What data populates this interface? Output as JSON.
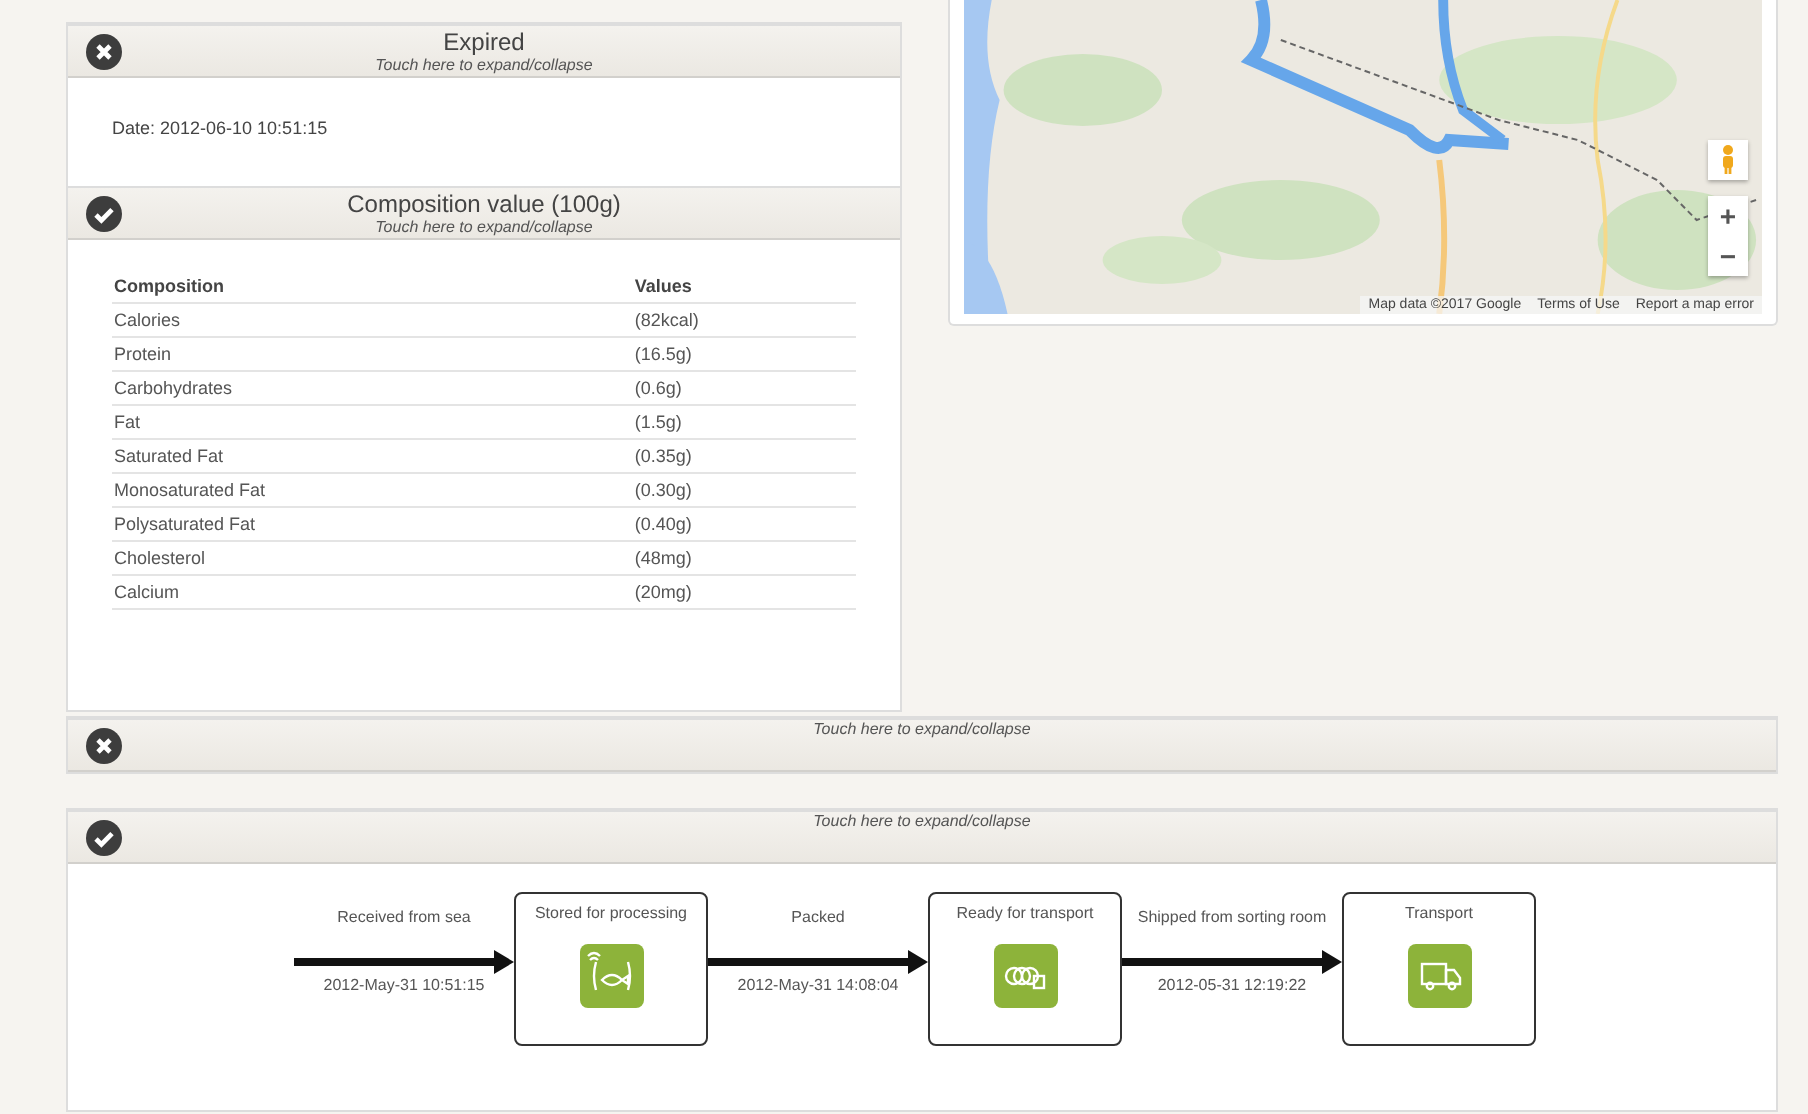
{
  "left_panels": [
    {
      "valid": false,
      "title": "Expired",
      "hint": "Touch here to expand/collapse",
      "kind": "text",
      "text": "Date: 2012-06-10 10:51:15"
    },
    {
      "valid": true,
      "title": "Composition value (100g)",
      "hint": "Touch here to expand/collapse",
      "kind": "table",
      "columns": [
        "Composition",
        "Values"
      ],
      "rows": [
        [
          "Calories",
          "(82kcal)"
        ],
        [
          "Protein",
          "(16.5g)"
        ],
        [
          "Carbohydrates",
          "(0.6g)"
        ],
        [
          "Fat",
          "(1.5g)"
        ],
        [
          "Saturated Fat",
          "(0.35g)"
        ],
        [
          "Monosaturated Fat",
          "(0.30g)"
        ],
        [
          "Polysaturated Fat",
          "(0.40g)"
        ],
        [
          "Cholesterol",
          "(48mg)"
        ],
        [
          "Calcium",
          "(20mg)"
        ]
      ]
    }
  ],
  "map": {
    "zoom_in": "+",
    "zoom_out": "−",
    "attribution": [
      "Map data ©2017 Google",
      "Terms of Use",
      "Report a map error"
    ]
  },
  "bottom_panels": [
    {
      "valid": false,
      "hint": "Touch here to expand/collapse"
    },
    {
      "valid": true,
      "hint": "Touch here to expand/collapse",
      "kind": "flow",
      "steps": [
        {
          "kind": "arrow",
          "label": "Received from sea",
          "date": "2012-May-31 10:51:15"
        },
        {
          "kind": "stage",
          "label": "Stored for processing"
        },
        {
          "kind": "arrow",
          "label": "Packed",
          "date": "2012-May-31 14:08:04"
        },
        {
          "kind": "stage",
          "label": "Ready for transport"
        },
        {
          "kind": "arrow",
          "label": "Shipped from sorting room",
          "date": "2012-05-31 12:19:22"
        },
        {
          "kind": "stage",
          "label": "Transport"
        }
      ]
    }
  ]
}
